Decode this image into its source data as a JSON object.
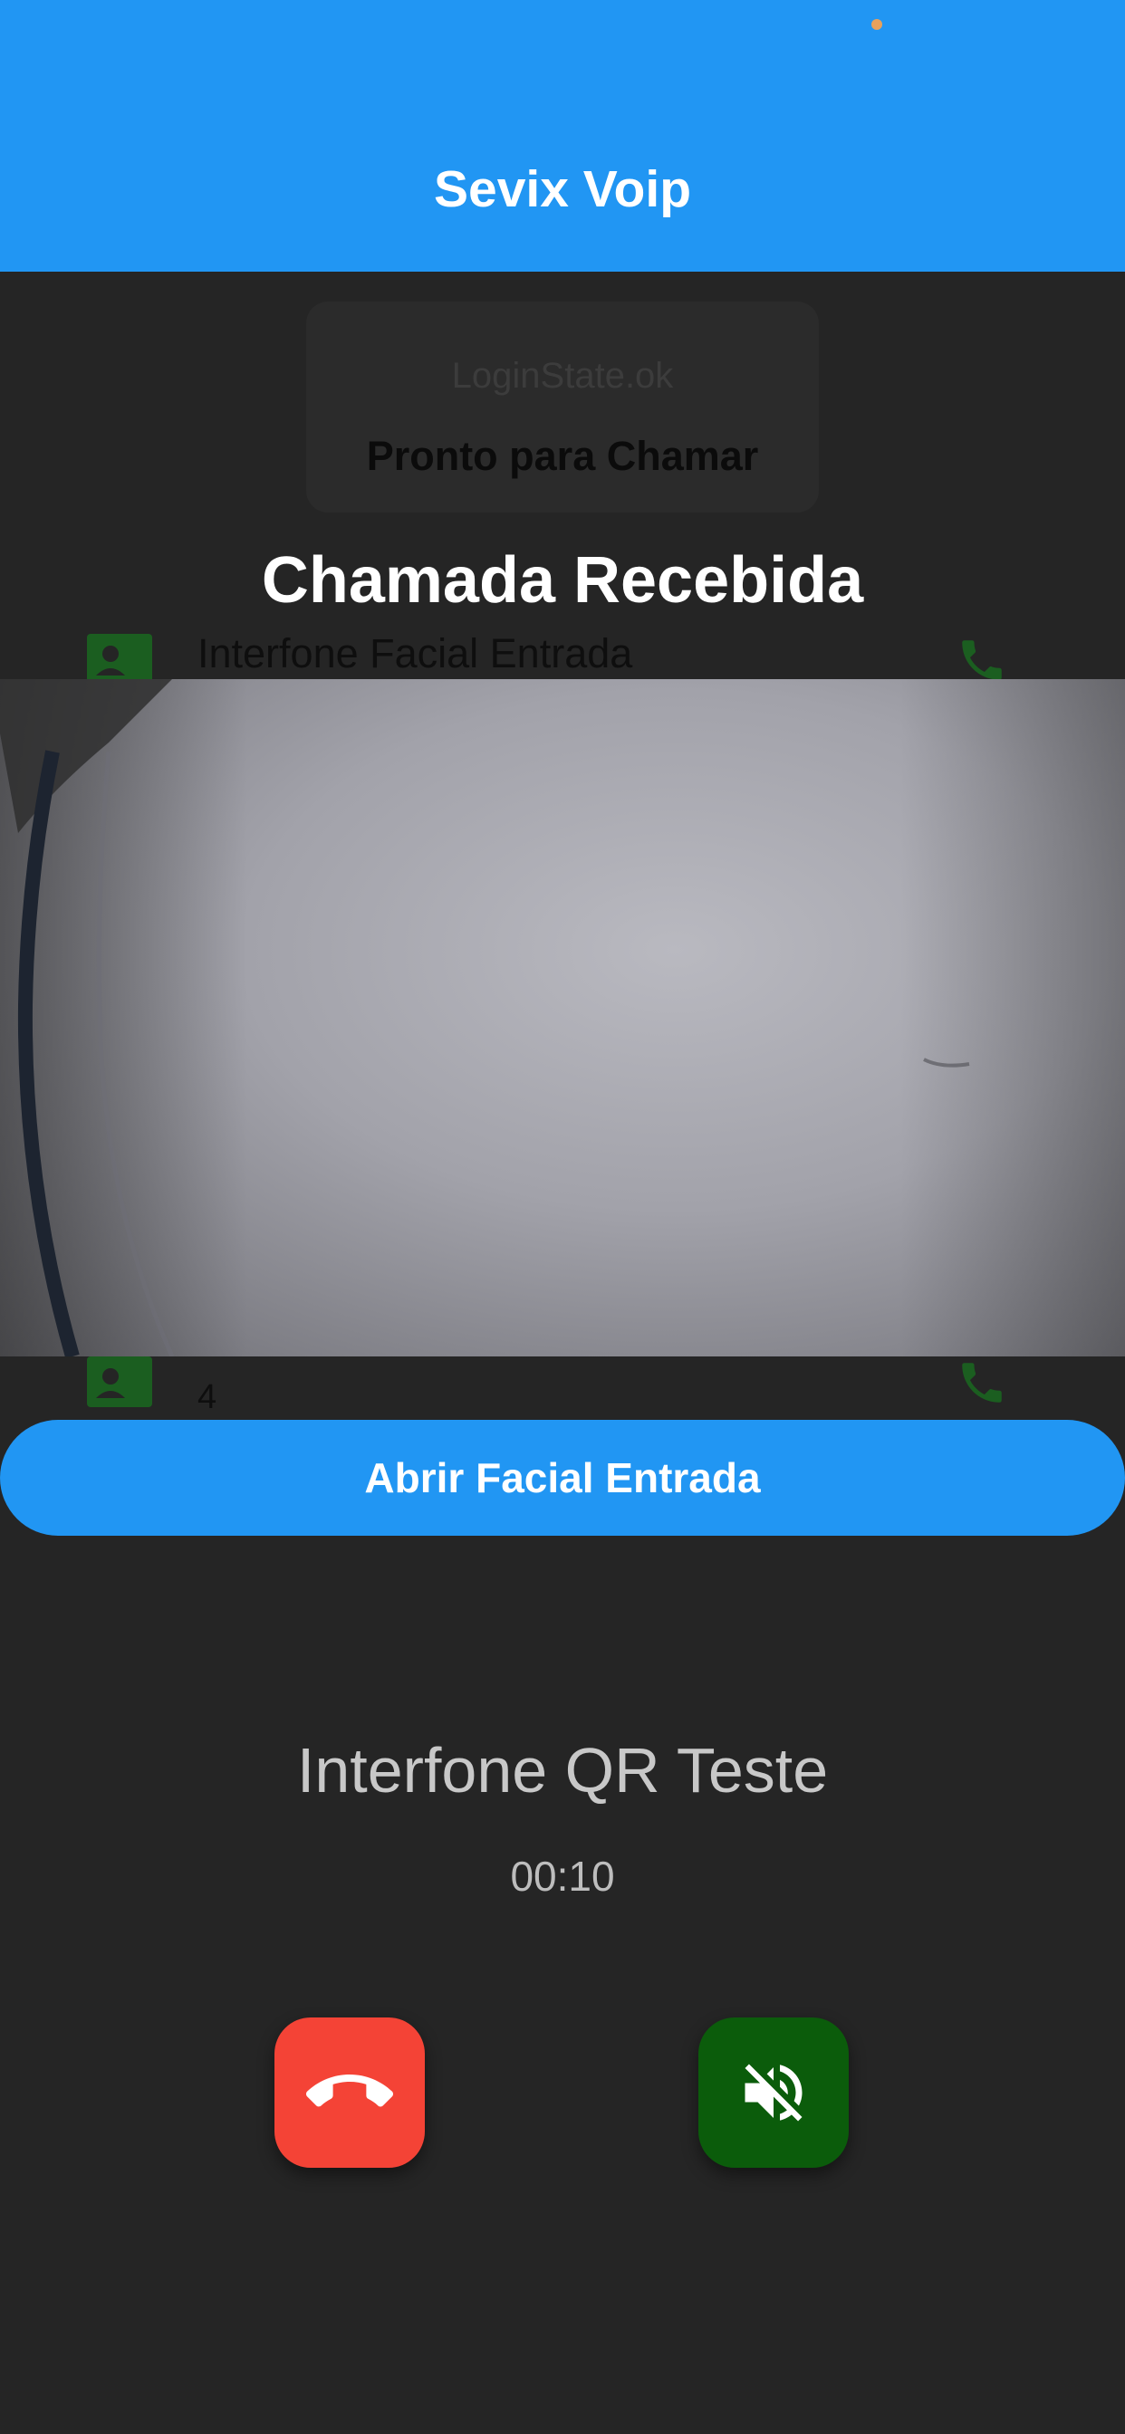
{
  "app": {
    "title": "Sevix Voip"
  },
  "background": {
    "status_card": {
      "login_state": "LoginState.ok",
      "ready_label": "Pronto para Chamar"
    },
    "rows": [
      {
        "title": "Interfone Facial Entrada",
        "subtitle": ""
      },
      {
        "title": "",
        "subtitle": "4"
      }
    ]
  },
  "call": {
    "overlay_title": "Chamada Recebida",
    "open_button_label": "Abrir Facial Entrada",
    "caller_name": "Interfone QR Teste",
    "timer": "00:10"
  },
  "icons": {
    "hangup": "call-end-icon",
    "mute": "volume-off-icon",
    "contact": "contact-icon",
    "call": "phone-icon"
  },
  "colors": {
    "primary": "#2196F3",
    "hangup": "#F44336",
    "mute": "#0B5C0B",
    "background": "#252525"
  }
}
